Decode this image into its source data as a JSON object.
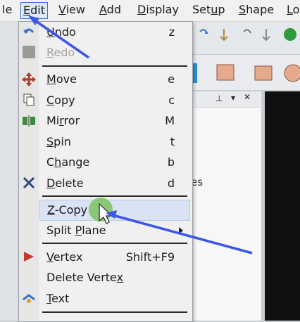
{
  "menubar": {
    "items": [
      {
        "pre": "",
        "u": "",
        "post": "le"
      },
      {
        "pre": "",
        "u": "E",
        "post": "dit"
      },
      {
        "pre": "",
        "u": "V",
        "post": "iew"
      },
      {
        "pre": "",
        "u": "A",
        "post": "dd"
      },
      {
        "pre": "",
        "u": "D",
        "post": "isplay"
      },
      {
        "pre": "Set",
        "u": "u",
        "post": "p"
      },
      {
        "pre": "",
        "u": "S",
        "post": "hape"
      },
      {
        "pre": "",
        "u": "L",
        "post": "o"
      }
    ]
  },
  "edit_menu": {
    "items": [
      {
        "pre": "",
        "u": "U",
        "post": "ndo",
        "key": "z"
      },
      {
        "pre": "",
        "u": "R",
        "post": "edo",
        "key": ""
      },
      {
        "pre": "",
        "u": "M",
        "post": "ove",
        "key": "e"
      },
      {
        "pre": "",
        "u": "C",
        "post": "opy",
        "key": "c"
      },
      {
        "pre": "Mi",
        "u": "r",
        "post": "ror",
        "key": "M"
      },
      {
        "pre": "",
        "u": "S",
        "post": "pin",
        "key": "t"
      },
      {
        "pre": "C",
        "u": "h",
        "post": "ange",
        "key": "b"
      },
      {
        "pre": "",
        "u": "D",
        "post": "elete",
        "key": "d"
      },
      {
        "pre": "",
        "u": "Z",
        "post": "-Copy",
        "key": ""
      },
      {
        "pre": "Split ",
        "u": "P",
        "post": "lane",
        "key": ""
      },
      {
        "pre": "",
        "u": "V",
        "post": "ertex",
        "key": "Shift+F9"
      },
      {
        "pre": "Delete Verte",
        "u": "x",
        "post": "",
        "key": ""
      },
      {
        "pre": "",
        "u": "T",
        "post": "ext",
        "key": ""
      }
    ]
  },
  "panel": {
    "fragment": "es"
  },
  "colors": {
    "annotation_arrow": "#3b56e8",
    "highlight_circle": "#6fbf4b"
  }
}
